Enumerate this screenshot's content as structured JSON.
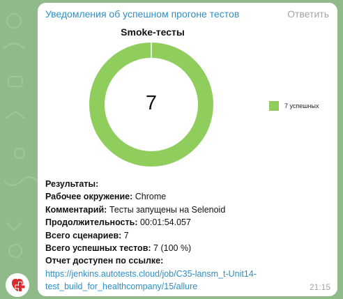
{
  "message": {
    "sender": "Уведомления об успешном прогоне тестов",
    "reply_label": "Ответить",
    "time": "21:15"
  },
  "chart_data": {
    "type": "pie",
    "title": "Smoke-тесты",
    "center_label": "7",
    "slices": [
      {
        "name": "7 успешных",
        "value": 7,
        "color": "#8fce5d"
      }
    ],
    "legend": {
      "position": "right",
      "entries": [
        "7 успешных"
      ]
    }
  },
  "report": {
    "results_label": "Результаты:",
    "env_label": "Рабочее окружение:",
    "env_value": "Chrome",
    "comment_label": "Комментарий:",
    "comment_value": "Тесты запущены на Selenoid",
    "duration_label": "Продолжительность:",
    "duration_value": "00:01:54.057",
    "total_label": "Всего сценариев:",
    "total_value": "7",
    "passed_label": "Всего успешных тестов:",
    "passed_value": "7 (100 %)",
    "link_label": "Отчет доступен по ссылке:",
    "link_line1": "https://jenkins.autotests.cloud/job/C35-lansm_t-Unit14-",
    "link_line2": "test_build_for_healthcompany/15/allure"
  },
  "colors": {
    "link": "#2f8fc4",
    "chart_green": "#8fce5d",
    "background": "#8fbb8a",
    "avatar_red": "#d92b2b"
  },
  "icons": {
    "avatar": "red-cross-heart-icon"
  }
}
